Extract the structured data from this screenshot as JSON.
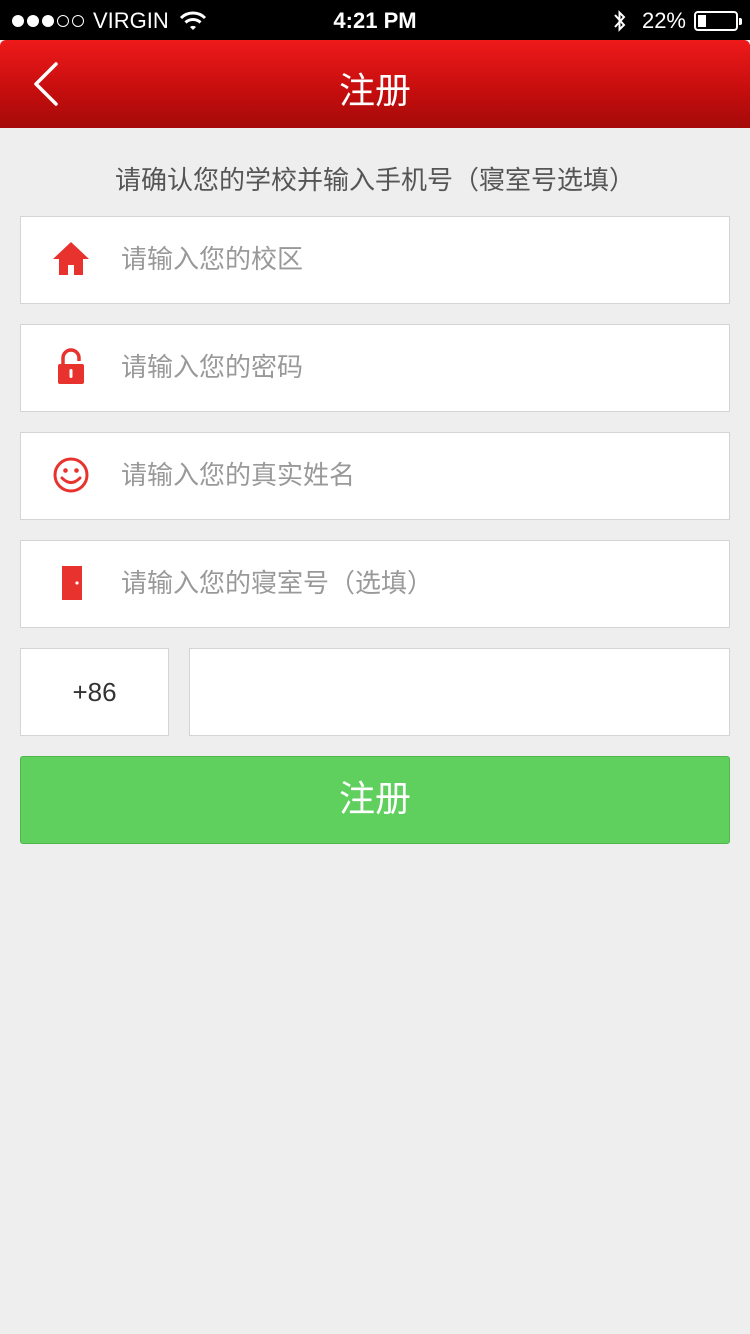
{
  "status_bar": {
    "carrier": "VIRGIN",
    "signal_filled": 3,
    "signal_total": 5,
    "time": "4:21 PM",
    "battery_text": "22%",
    "battery_level": 0.22
  },
  "nav": {
    "title": "注册",
    "back_icon": "chevron-left-icon"
  },
  "instruction": "请确认您的学校并输入手机号（寝室号选填）",
  "fields": {
    "campus": {
      "placeholder": "请输入您的校区",
      "icon": "home-icon"
    },
    "password": {
      "placeholder": "请输入您的密码",
      "icon": "lock-icon"
    },
    "name": {
      "placeholder": "请输入您的真实姓名",
      "icon": "smiley-icon"
    },
    "dorm": {
      "placeholder": "请输入您的寝室号（选填）",
      "icon": "door-icon"
    }
  },
  "phone": {
    "country_code": "+86",
    "value": ""
  },
  "register_button": "注册",
  "colors": {
    "nav_red": "#d71212",
    "icon_red": "#e8322e",
    "button_green": "#5fcf5d",
    "background": "#eeeeee"
  }
}
